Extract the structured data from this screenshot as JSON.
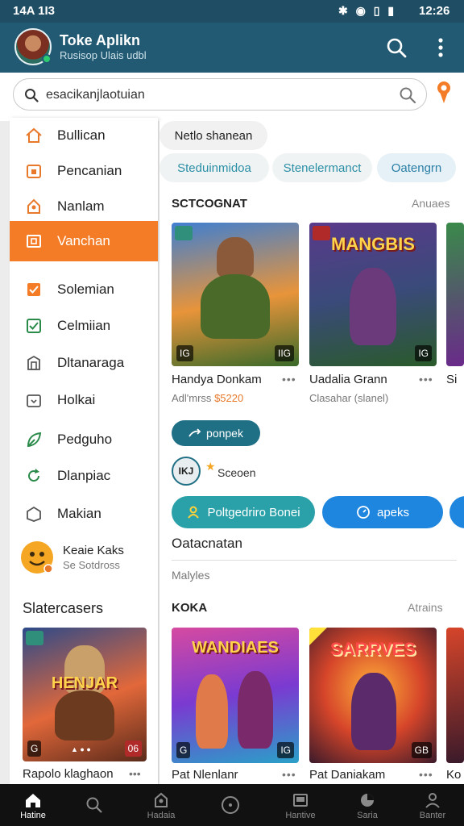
{
  "status": {
    "left": "14A 1I3",
    "right": "12:26",
    "icons": "✱ ◉ ▯ ▮"
  },
  "header": {
    "title": "Toke Aplikn",
    "subtitle": "Rusisop Ulais udbl"
  },
  "search": {
    "placeholder": "esacikanjlaotuian"
  },
  "sidebar": {
    "items": [
      {
        "label": "Bullican",
        "icon": "home-icon"
      },
      {
        "label": "Pencanian",
        "icon": "calendar-icon"
      },
      {
        "label": "Nanlam",
        "icon": "tag-icon"
      },
      {
        "label": "Vanchan",
        "icon": "image-icon",
        "active": true
      },
      {
        "label": "Solemian",
        "icon": "checkbox-filled-icon"
      },
      {
        "label": "Celmiian",
        "icon": "checkbox-icon"
      },
      {
        "label": "Dltanaraga",
        "icon": "building-icon"
      },
      {
        "label": "Holkai",
        "icon": "bag-icon"
      },
      {
        "label": "Pedguho",
        "icon": "leaf-icon"
      },
      {
        "label": "Dlanpiac",
        "icon": "refresh-icon"
      },
      {
        "label": "Makian",
        "icon": "box-icon"
      }
    ],
    "profile": {
      "name": "Keaie Kaks",
      "subtitle": "Se Sotdross"
    },
    "section_title": "Slatercasers",
    "card": {
      "title": "Rapolo klaghaon",
      "logo": "HENJAR",
      "tl": "",
      "bl": "G",
      "br": "06",
      "badge": "▲ ● ●"
    }
  },
  "main": {
    "chips": [
      {
        "label": "Netlo shanean"
      },
      {
        "label": "Steduinmidoa"
      },
      {
        "label": "Stenelermanct"
      },
      {
        "label": "Oatengrn"
      }
    ],
    "section1": {
      "title": "SCTCOGNAT",
      "link": "Anuaes"
    },
    "games1": [
      {
        "title": "Handya Donkam",
        "sub_prefix": "Adl'mrss",
        "price": "$5220",
        "bl": "IG",
        "br": "IIG",
        "logo": ""
      },
      {
        "title": "Uadalia Grann",
        "sub": "Clasahar (slanel)",
        "bl": "",
        "br": "IG",
        "logo": "MANGBIS"
      },
      {
        "title": "Si"
      }
    ],
    "action_pill": "ponpek",
    "rating": {
      "badge": "IKJ",
      "star": "★",
      "label": "Sceoen"
    },
    "big_buttons": [
      {
        "label": "Poltgedriro Bonei"
      },
      {
        "label": "apeks"
      }
    ],
    "section_label": "Oatacnatan",
    "section_sub": "Malyles",
    "section2": {
      "title": "KOKA",
      "link": "Atrains"
    },
    "games2": [
      {
        "title": "Pat Nlenlanr",
        "logo": "WANDIAES",
        "bl": "G",
        "br": "IG"
      },
      {
        "title": "Pat Daniakam",
        "logo": "SARRVES",
        "bl": "",
        "br": "GB"
      },
      {
        "title": "Ko"
      }
    ]
  },
  "bottom_nav": [
    {
      "label": "Hatine",
      "icon": "home-icon",
      "active": true
    },
    {
      "label": "",
      "icon": "search-icon"
    },
    {
      "label": "Hadaia",
      "icon": "bag-icon"
    },
    {
      "label": "",
      "icon": "compass-icon"
    },
    {
      "label": "Hantive",
      "icon": "image-icon"
    },
    {
      "label": "Saria",
      "icon": "pie-icon"
    },
    {
      "label": "Banter",
      "icon": "profile-icon"
    }
  ],
  "colors": {
    "appbar": "#215a72",
    "accent": "#f47c26",
    "teal": "#2b8fa6",
    "blue": "#1f86df"
  }
}
